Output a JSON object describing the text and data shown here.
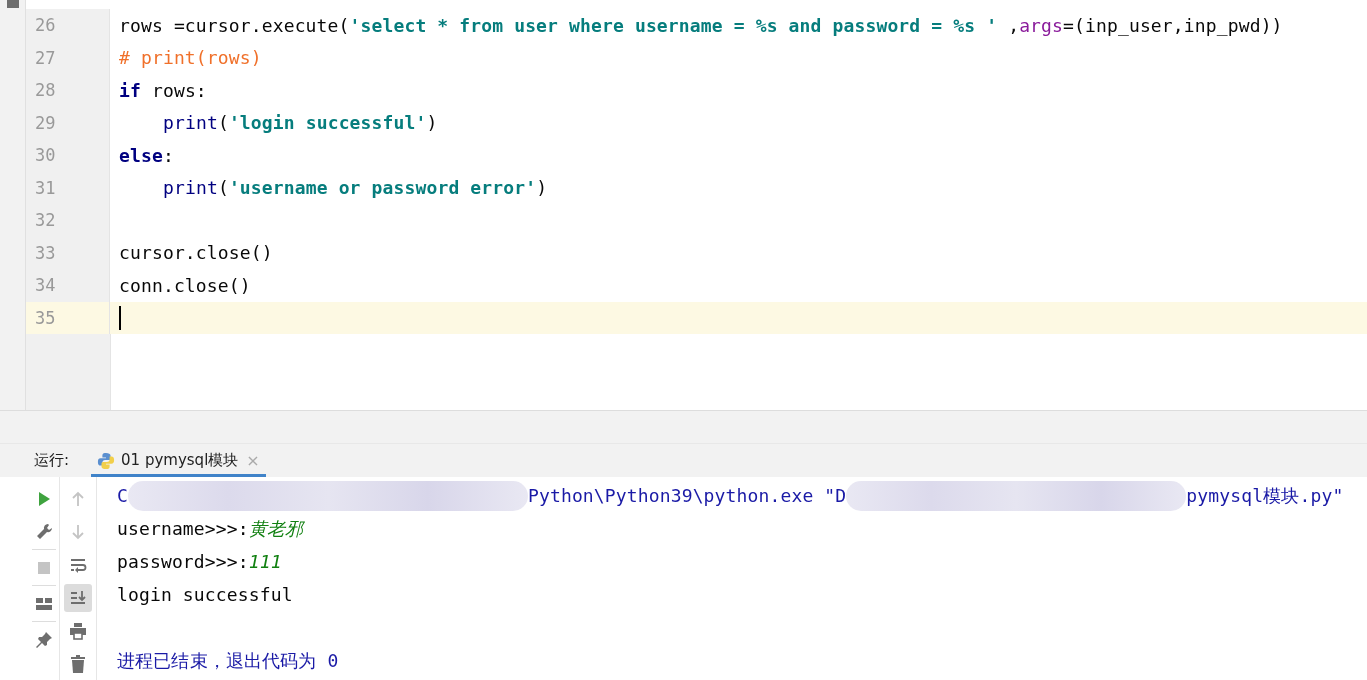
{
  "editor": {
    "lines": [
      {
        "number": "26",
        "current": false,
        "tokens": [
          {
            "kind": "plain",
            "text": "rows =cursor.execute("
          },
          {
            "kind": "string",
            "text": "'select * from user where username = %s and password = %s '"
          },
          {
            "kind": "plain",
            "text": " ,"
          },
          {
            "kind": "param",
            "text": "args"
          },
          {
            "kind": "plain",
            "text": "=(inp_user,inp_pwd))"
          }
        ]
      },
      {
        "number": "27",
        "current": false,
        "tokens": [
          {
            "kind": "comment",
            "text": "# print(rows)"
          }
        ]
      },
      {
        "number": "28",
        "current": false,
        "tokens": [
          {
            "kind": "keyword",
            "text": "if"
          },
          {
            "kind": "plain",
            "text": " rows:"
          }
        ],
        "children": [
          {
            "number": "29",
            "current": false,
            "tokens": [
              {
                "kind": "builtin",
                "text": "print"
              },
              {
                "kind": "plain",
                "text": "("
              },
              {
                "kind": "string",
                "text": "'login successful'"
              },
              {
                "kind": "plain",
                "text": ")"
              }
            ]
          }
        ]
      },
      {
        "number": "30",
        "current": false,
        "tokens": [
          {
            "kind": "keyword",
            "text": "else"
          },
          {
            "kind": "plain",
            "text": ":"
          }
        ],
        "children": [
          {
            "number": "31",
            "current": false,
            "tokens": [
              {
                "kind": "builtin",
                "text": "print"
              },
              {
                "kind": "plain",
                "text": "("
              },
              {
                "kind": "string",
                "text": "'username or password error'"
              },
              {
                "kind": "plain",
                "text": ")"
              }
            ]
          }
        ]
      },
      {
        "number": "32",
        "current": false
      },
      {
        "number": "33",
        "current": false,
        "tokens": [
          {
            "kind": "plain",
            "text": "cursor.close()"
          }
        ]
      },
      {
        "number": "34",
        "current": false,
        "tokens": [
          {
            "kind": "plain",
            "text": "conn.close()"
          }
        ]
      },
      {
        "number": "35",
        "current": true
      }
    ]
  },
  "run_panel": {
    "label": "运行:",
    "tab": {
      "title": "01 pymysql模块",
      "close": "×",
      "selected": true
    },
    "left_toolbar": [
      {
        "kind": "run",
        "disabled": false
      },
      {
        "kind": "wrench",
        "disabled": false
      },
      {
        "kind": "stop",
        "disabled": true
      },
      {
        "kind": "layout",
        "disabled": false
      },
      {
        "kind": "pin",
        "disabled": false
      }
    ],
    "right_toolbar": [
      {
        "kind": "up",
        "disabled": true,
        "selected": false
      },
      {
        "kind": "down",
        "disabled": true,
        "selected": false
      },
      {
        "kind": "wrap",
        "disabled": false,
        "selected": false
      },
      {
        "kind": "scroll-end",
        "disabled": false,
        "selected": true
      },
      {
        "kind": "print",
        "disabled": false,
        "selected": false
      },
      {
        "kind": "trash",
        "disabled": false,
        "selected": false
      }
    ],
    "console": [
      {
        "segments": [
          {
            "kind": "system",
            "text": "C"
          },
          {
            "kind": "redacted"
          },
          {
            "kind": "system",
            "text": "Python\\Python39\\python.exe \"D"
          },
          {
            "kind": "redacted"
          },
          {
            "kind": "system",
            "text": "pymysql模块.py\""
          }
        ]
      },
      {
        "segments": [
          {
            "kind": "output",
            "text": "username>>>:"
          },
          {
            "kind": "input",
            "text": "黄老邪"
          }
        ]
      },
      {
        "segments": [
          {
            "kind": "output",
            "text": "password>>>:"
          },
          {
            "kind": "input",
            "text": "111"
          }
        ]
      },
      {
        "segments": [
          {
            "kind": "output",
            "text": "login successful"
          }
        ]
      },
      {
        "kind": "exit_message",
        "segments": [
          {
            "kind": "system",
            "text": "进程已结束，退出代码为 0"
          }
        ]
      }
    ]
  }
}
